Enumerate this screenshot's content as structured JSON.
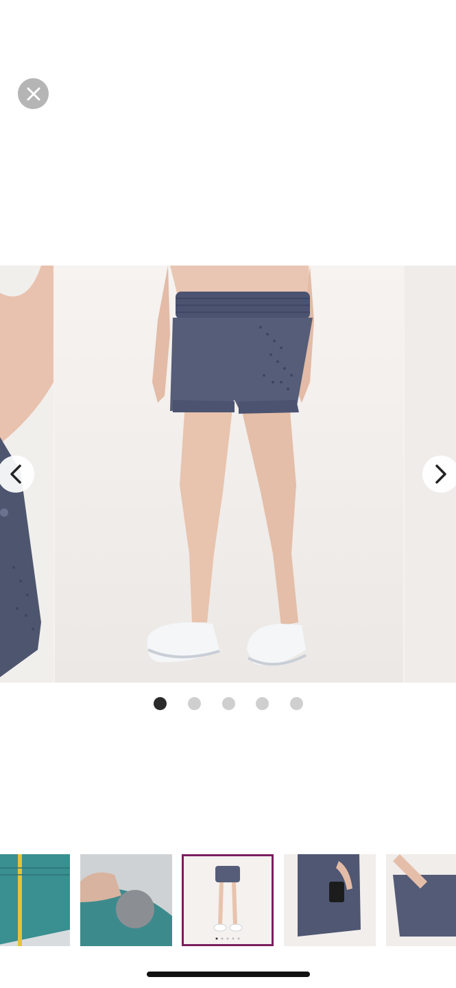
{
  "viewer": {
    "close_icon": "close-icon",
    "nav_prev_icon": "chevron-left-icon",
    "nav_next_icon": "chevron-right-icon"
  },
  "carousel": {
    "slide_count": 5,
    "active_index": 0,
    "product_color": "#555d78",
    "accent_border": "#7a1d5f"
  },
  "thumbnails": {
    "count": 5,
    "selected_index": 2
  }
}
